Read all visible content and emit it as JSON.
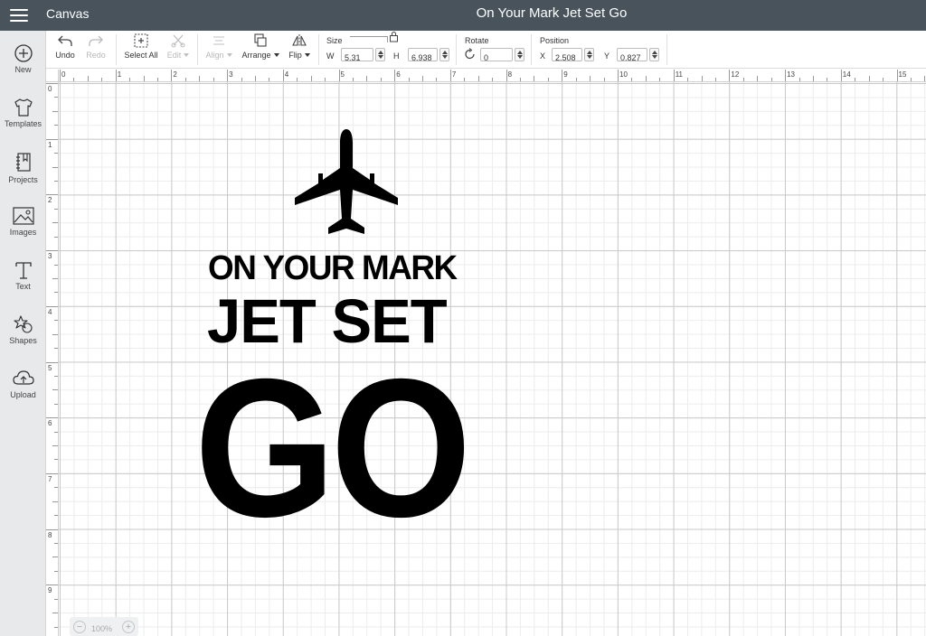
{
  "header": {
    "app_title": "Canvas",
    "project_title": "On Your Mark Jet Set Go"
  },
  "sidebar": {
    "items": [
      {
        "label": "New",
        "icon": "plus-circle-icon"
      },
      {
        "label": "Templates",
        "icon": "tshirt-icon"
      },
      {
        "label": "Projects",
        "icon": "notebook-icon"
      },
      {
        "label": "Images",
        "icon": "image-icon"
      },
      {
        "label": "Text",
        "icon": "text-t-icon"
      },
      {
        "label": "Shapes",
        "icon": "shapes-icon"
      },
      {
        "label": "Upload",
        "icon": "cloud-upload-icon"
      }
    ]
  },
  "toolbar": {
    "undo_label": "Undo",
    "redo_label": "Redo",
    "select_all_label": "Select All",
    "edit_label": "Edit",
    "align_label": "Align",
    "arrange_label": "Arrange",
    "flip_label": "Flip",
    "size_label": "Size",
    "width_label": "W",
    "width_value": "5.31",
    "height_label": "H",
    "height_value": "6.938",
    "rotate_label": "Rotate",
    "rotate_value": "0",
    "position_label": "Position",
    "x_label": "X",
    "x_value": "2.508",
    "y_label": "Y",
    "y_value": "0.827"
  },
  "rulers": {
    "horizontal": [
      "0",
      "1",
      "2",
      "3",
      "4",
      "5",
      "6",
      "7",
      "8",
      "9",
      "10",
      "11",
      "12",
      "13",
      "14",
      "15"
    ],
    "vertical": [
      "0",
      "1",
      "2",
      "3",
      "4",
      "5",
      "6",
      "7",
      "8",
      "9"
    ]
  },
  "design": {
    "line1": "ON YOUR MARK",
    "line2": "JET SET",
    "line3": "GO",
    "icon": "airplane-icon",
    "color": "#000000"
  },
  "zoom": {
    "level": "100%",
    "minus": "−",
    "plus": "+"
  },
  "colors": {
    "topbar": "#48535b",
    "sidebar": "#e8e9ea",
    "grid_major": "#c9c9c9",
    "grid_minor": "#ececec"
  }
}
